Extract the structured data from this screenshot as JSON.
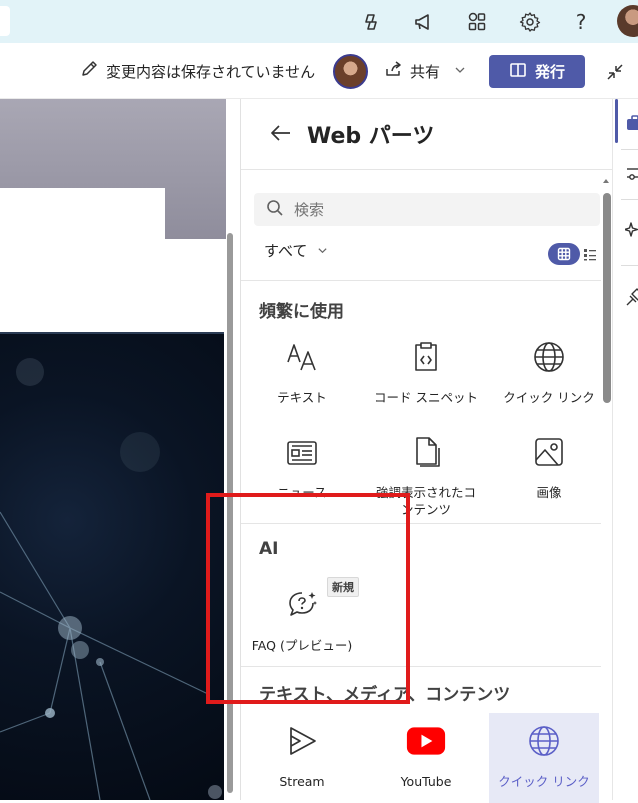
{
  "topbar": {
    "icons": [
      "copilot-icon",
      "megaphone-icon",
      "apps-icon",
      "gear-icon",
      "help-icon",
      "user-avatar"
    ],
    "help_label": "?"
  },
  "commandbar": {
    "save_status": "変更内容は保存されていません",
    "share_label": "共有",
    "publish_label": "発行"
  },
  "panel": {
    "title": "Web パーツ",
    "search_placeholder": "検索",
    "filter_label": "すべて",
    "sections": {
      "frequent": {
        "title": "頻繁に使用",
        "items": [
          {
            "label": "テキスト",
            "icon": "text-icon"
          },
          {
            "label": "コード スニペット",
            "icon": "code-snippet-icon"
          },
          {
            "label": "クイック リンク",
            "icon": "globe-icon"
          },
          {
            "label": "ニュース",
            "icon": "news-icon"
          },
          {
            "label": "強調表示されたコンテンツ",
            "icon": "document-icon"
          },
          {
            "label": "画像",
            "icon": "image-icon"
          }
        ]
      },
      "ai": {
        "title": "AI",
        "items": [
          {
            "label": "FAQ (プレビュー)",
            "icon": "faq-icon",
            "badge": "新規"
          }
        ]
      },
      "media": {
        "title": "テキスト、メディア、コンテンツ",
        "items": [
          {
            "label": "Stream",
            "icon": "stream-icon"
          },
          {
            "label": "YouTube",
            "icon": "youtube-icon"
          },
          {
            "label": "クイック リンク",
            "icon": "globe-icon",
            "selected": true
          }
        ]
      }
    }
  },
  "colors": {
    "topbar_bg": "#e2f3f8",
    "accent": "#4f5aa8",
    "highlight": "#e01b1b",
    "youtube_red": "#ff0000"
  }
}
